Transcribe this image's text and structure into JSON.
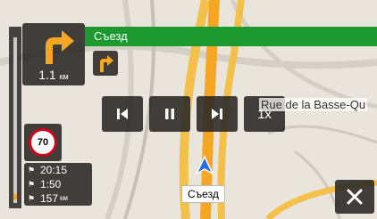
{
  "instruction": {
    "street": "Съезд",
    "distance": "1.1",
    "unit": "км"
  },
  "speed_limit": "70",
  "playback": {
    "speed_label": "1x"
  },
  "eta": {
    "arrival": "20:15",
    "remaining_time": "1:50",
    "remaining_distance": "157",
    "distance_unit": "км"
  },
  "map": {
    "street_label": "Rue de la Basse-Qu",
    "current_road": "Съезд"
  },
  "progress": {
    "fraction": 0.03
  },
  "colors": {
    "banner": "#1c9a30",
    "route": "#f5a623",
    "road": "#f3c14a",
    "speed_ring": "#d0021b",
    "panel": "#282624"
  },
  "icons": {
    "turn": "turn-right-arrow-icon",
    "next_turn": "turn-right-small-icon",
    "close": "close-icon",
    "vehicle": "navigation-arrow-icon"
  }
}
